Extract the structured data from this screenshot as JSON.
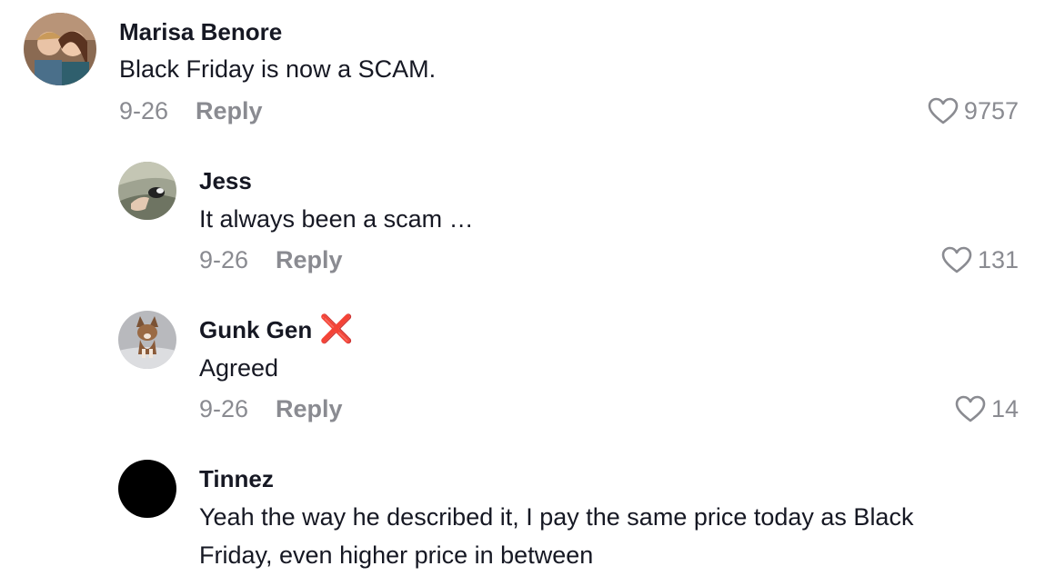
{
  "comments": [
    {
      "username": "Marisa Benore",
      "text": "Black Friday is now a SCAM.",
      "date": "9-26",
      "reply_label": "Reply",
      "likes": "9757",
      "avatar": "couple-photo"
    },
    {
      "username": "Jess",
      "text": "It always been a scam …",
      "date": "9-26",
      "reply_label": "Reply",
      "likes": "131",
      "avatar": "bird-in-hand-photo"
    },
    {
      "username": "Gunk Gen",
      "badge": "❌",
      "text": "Agreed",
      "date": "9-26",
      "reply_label": "Reply",
      "likes": "14",
      "avatar": "chihuahua-photo"
    },
    {
      "username": "Tinnez",
      "text_lines": [
        "Yeah the way he described it, I pay the same price today as Black",
        "Friday, even higher price in between"
      ],
      "avatar": "black-circle"
    }
  ],
  "colors": {
    "text": "#161823",
    "meta": "#8a8b91",
    "badge": "#e0282e"
  }
}
